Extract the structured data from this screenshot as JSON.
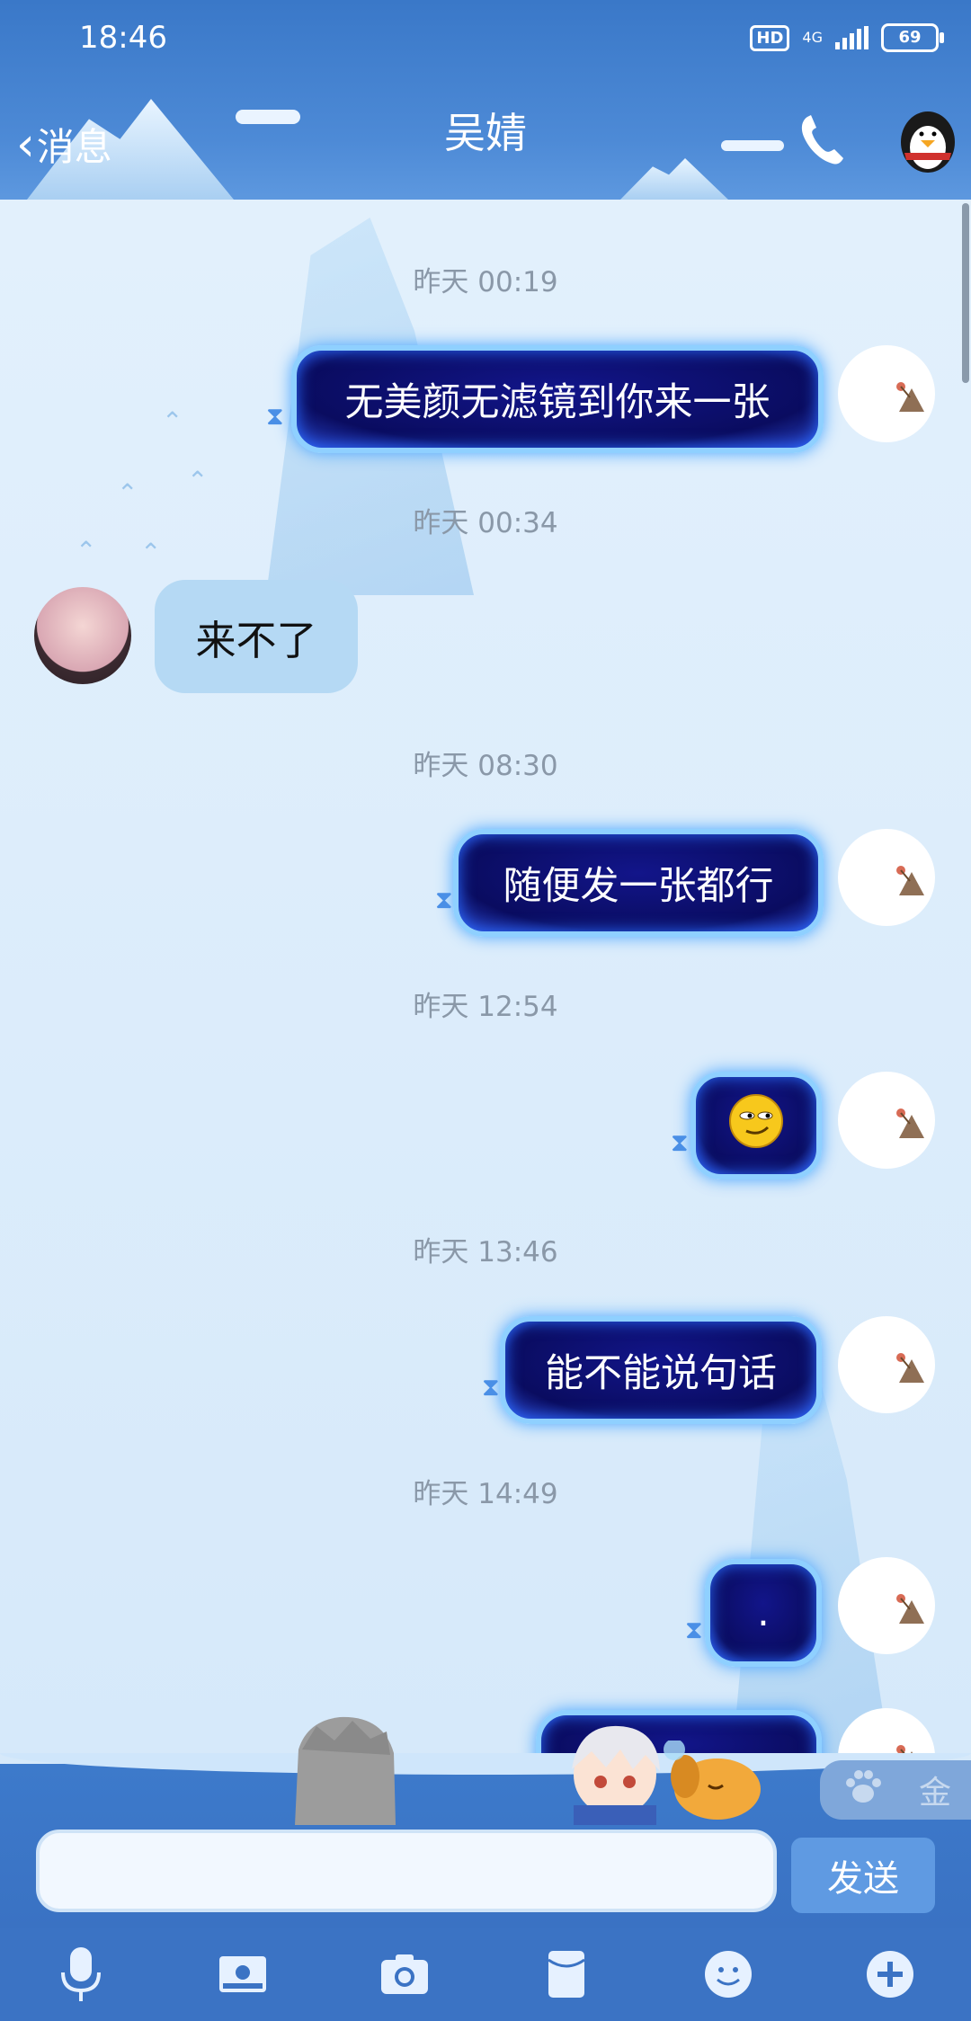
{
  "status": {
    "time": "18:46",
    "hd": "HD",
    "network": "4G",
    "battery": "69"
  },
  "header": {
    "back_label": "消息",
    "title": "吴婧"
  },
  "messages": [
    {
      "timestamp": "昨天 00:19",
      "text": "无美颜无滤镜到你来一张",
      "from": "self"
    },
    {
      "timestamp": "昨天 00:34",
      "text": "来不了",
      "from": "other"
    },
    {
      "timestamp": "昨天 08:30",
      "text": "随便发一张都行",
      "from": "self"
    },
    {
      "timestamp": "昨天 12:54",
      "text": "",
      "from": "self",
      "emoji": "smirk"
    },
    {
      "timestamp": "昨天 13:46",
      "text": "能不能说句话",
      "from": "self"
    },
    {
      "timestamp": "昨天 14:49",
      "text": ".",
      "from": "self"
    }
  ],
  "input": {
    "send_label": "发送",
    "placeholder": ""
  },
  "side_panel": {
    "label": "金"
  },
  "toolbar": [
    "microphone-icon",
    "photo-icon",
    "camera-icon",
    "red-envelope-icon",
    "emoji-icon",
    "plus-icon"
  ],
  "colors": {
    "accent": "#3b73c4",
    "bubble_self": "#0a0c60",
    "bubble_other": "#b5d9f4"
  }
}
